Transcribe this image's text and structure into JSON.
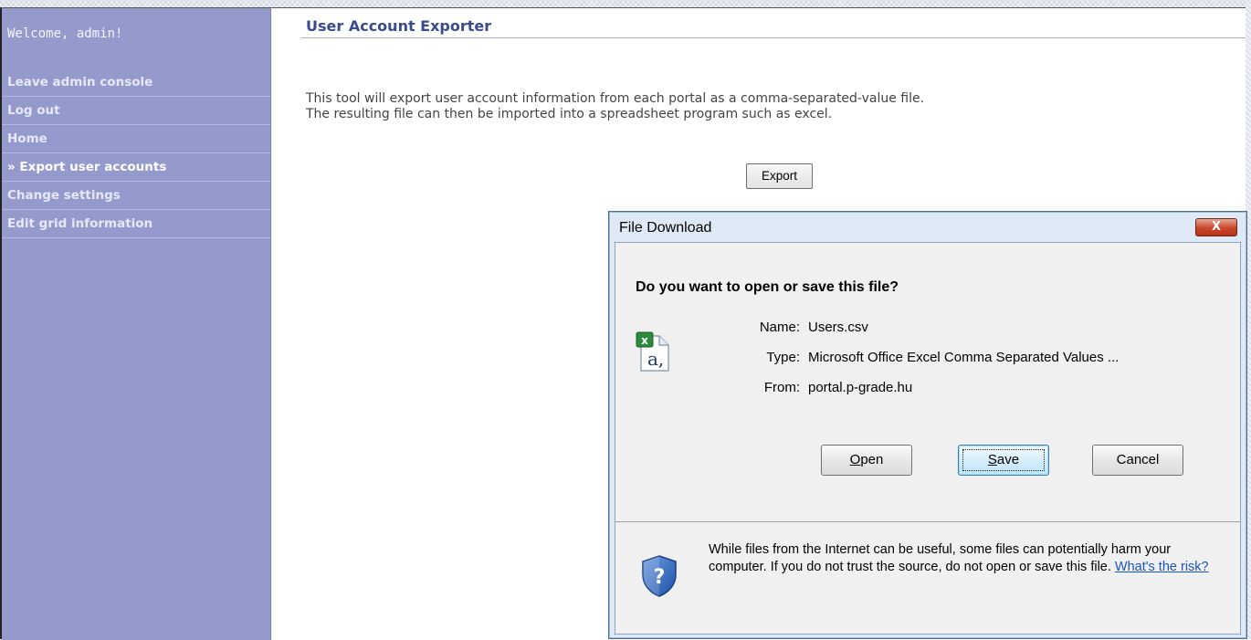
{
  "sidebar": {
    "welcome": "Welcome, admin!",
    "items": [
      {
        "label": "Leave admin console"
      },
      {
        "label": "Log out"
      },
      {
        "label": "Home"
      },
      {
        "label": "» Export user accounts"
      },
      {
        "label": "Change settings"
      },
      {
        "label": "Edit grid information"
      }
    ],
    "active_index": 3
  },
  "main": {
    "title": "User Account Exporter",
    "description_line1": "This tool will export user account information from each portal as a comma-separated-value file.",
    "description_line2": "The resulting file can then be imported into a spreadsheet program such as excel.",
    "export_button": "Export"
  },
  "dialog": {
    "title": "File Download",
    "close_label": "X",
    "question": "Do you want to open or save this file?",
    "file_icon": "excel-csv-file-icon",
    "name_label": "Name:",
    "name_value": "Users.csv",
    "type_label": "Type:",
    "type_value": "Microsoft Office Excel Comma Separated Values ...",
    "from_label": "From:",
    "from_value": "portal.p-grade.hu",
    "open_hotkey": "O",
    "open_rest": "pen",
    "save_hotkey": "S",
    "save_rest": "ave",
    "cancel_button": "Cancel",
    "warning_icon": "security-shield-question-icon",
    "warning_text": "While files from the Internet can be useful, some files can potentially harm your computer. If you do not trust the source, do not open or save this file.",
    "risk_link": "What's the risk?"
  },
  "colors": {
    "sidebar_bg": "#949bcc",
    "heading": "#3a4a8e",
    "link": "#1a55c8",
    "dialog_frame": "#dfe9f5",
    "close_button": "#c7452a"
  }
}
